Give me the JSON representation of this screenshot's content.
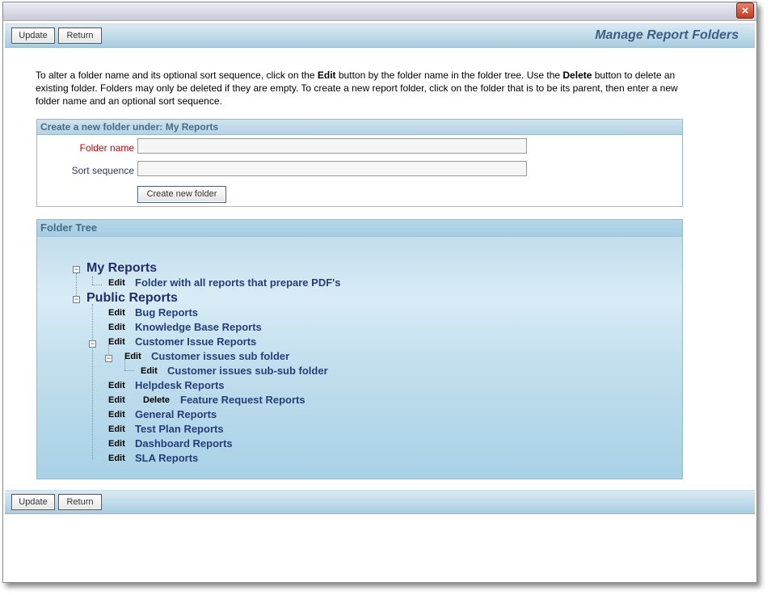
{
  "window": {
    "close_symbol": "×"
  },
  "toolbar": {
    "update_label": "Update",
    "return_label": "Return",
    "title": "Manage Report Folders"
  },
  "instructions": {
    "p1": "To alter a folder name and its optional sort sequence, click on the ",
    "edit_word": "Edit",
    "p2": " button by the folder name in the folder tree. Use the ",
    "delete_word": "Delete",
    "p3": " button to delete an existing folder. Folders may only be deleted if they are empty. To create a new report folder, click on the folder that is to be its parent, then enter a new folder name and an optional sort sequence."
  },
  "new_folder": {
    "header": "Create a new folder under: My Reports",
    "folder_name_label": "Folder name",
    "folder_name_value": "",
    "sort_label": "Sort sequence",
    "sort_value": "",
    "create_button": "Create new folder"
  },
  "tree": {
    "header": "Folder Tree",
    "edit_label": "Edit",
    "delete_label": "Delete",
    "toggle_symbol": "−",
    "roots": [
      {
        "label": "My Reports",
        "children": [
          {
            "name": "Folder with all reports that prepare PDF's"
          }
        ]
      },
      {
        "label": "Public Reports",
        "children": [
          {
            "name": "Bug Reports"
          },
          {
            "name": "Knowledge Base Reports"
          },
          {
            "name": "Customer Issue Reports",
            "children": [
              {
                "name": "Customer issues sub folder",
                "children": [
                  {
                    "name": "Customer issues sub-sub folder"
                  }
                ]
              }
            ]
          },
          {
            "name": "Helpdesk Reports"
          },
          {
            "name": "Feature Request Reports",
            "has_delete": true
          },
          {
            "name": "General Reports"
          },
          {
            "name": "Test Plan Reports"
          },
          {
            "name": "Dashboard Reports"
          },
          {
            "name": "SLA Reports"
          }
        ]
      }
    ]
  }
}
